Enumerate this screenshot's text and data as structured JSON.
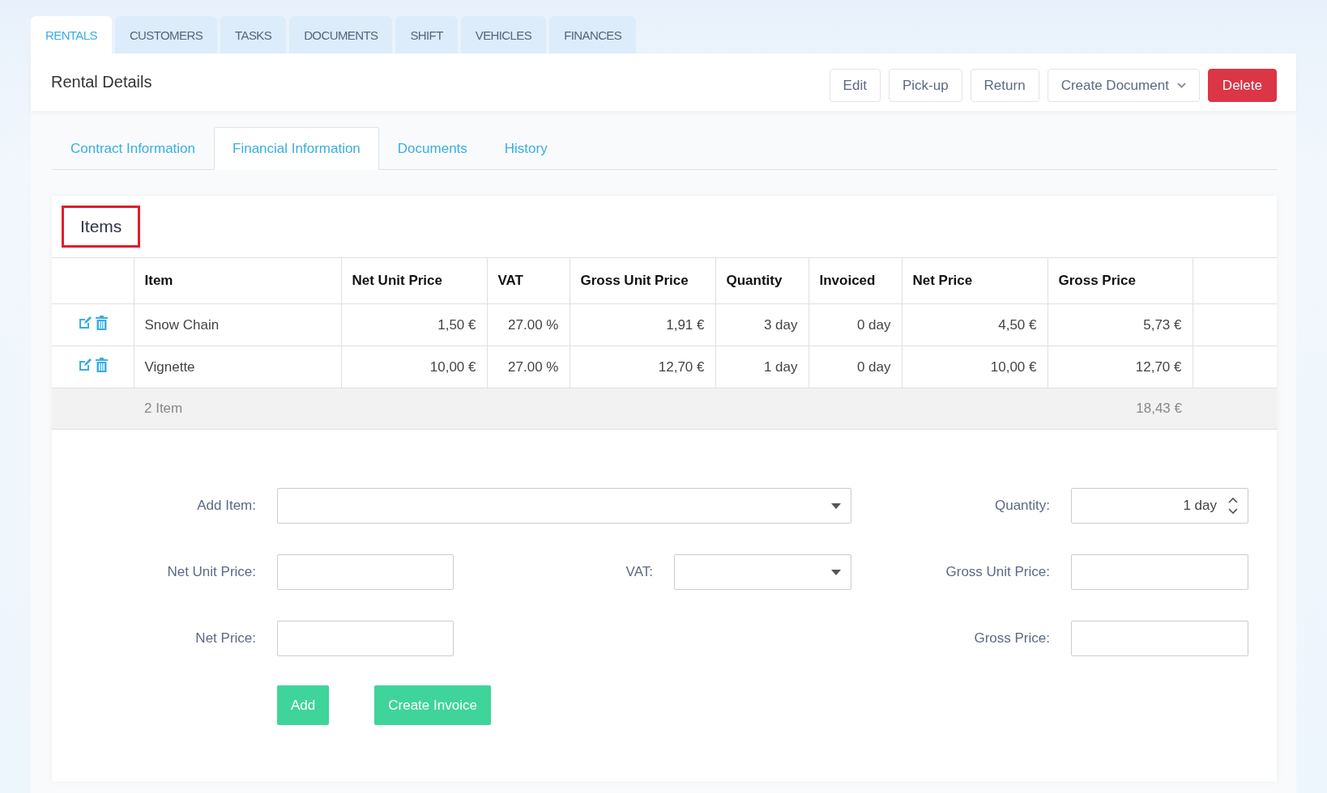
{
  "nav_tabs": [
    {
      "label": "RENTALS",
      "selected": true
    },
    {
      "label": "CUSTOMERS",
      "selected": false
    },
    {
      "label": "TASKS",
      "selected": false
    },
    {
      "label": "DOCUMENTS",
      "selected": false
    },
    {
      "label": "SHIFT",
      "selected": false
    },
    {
      "label": "VEHICLES",
      "selected": false
    },
    {
      "label": "FINANCES",
      "selected": false
    }
  ],
  "page": {
    "title": "Rental Details",
    "actions": [
      {
        "label": "Edit",
        "kind": "default"
      },
      {
        "label": "Pick-up",
        "kind": "default"
      },
      {
        "label": "Return",
        "kind": "default"
      },
      {
        "label": "Create Document",
        "kind": "dropdown"
      },
      {
        "label": "Delete",
        "kind": "danger"
      }
    ]
  },
  "sub_tabs": [
    {
      "label": "Contract Information",
      "selected": false
    },
    {
      "label": "Financial Information",
      "selected": true
    },
    {
      "label": "Documents",
      "selected": false
    },
    {
      "label": "History",
      "selected": false
    }
  ],
  "items_card": {
    "title": "Items",
    "highlighted": true,
    "columns": [
      "Item",
      "Net Unit Price",
      "VAT",
      "Gross Unit Price",
      "Quantity",
      "Invoiced",
      "Net Price",
      "Gross Price"
    ],
    "rows": [
      {
        "cells": [
          "Snow Chain",
          "1,50 €",
          "27.00 %",
          "1,91 €",
          "3 day",
          "0 day",
          "4,50 €",
          "5,73 €"
        ]
      },
      {
        "cells": [
          "Vignette",
          "10,00 €",
          "27.00 %",
          "12,70 €",
          "1 day",
          "0 day",
          "10,00 €",
          "12,70 €"
        ]
      }
    ],
    "footer": {
      "count": "2 Item",
      "total": "18,43 €"
    }
  },
  "form": {
    "rows": [
      [
        {
          "label": "Add Item:",
          "kind": "select",
          "wide": true
        },
        {
          "label": "Quantity:",
          "kind": "spinner",
          "value": "1 day"
        }
      ],
      [
        {
          "label": "Net Unit Price:",
          "kind": "input"
        },
        {
          "label": "VAT:",
          "kind": "select"
        },
        {
          "label": "Gross Unit Price:",
          "kind": "input"
        }
      ],
      [
        {
          "label": "Net Price:",
          "kind": "input"
        },
        {
          "label": "Gross Price:",
          "kind": "input"
        }
      ]
    ],
    "buttons": [
      "Add",
      "Create Invoice"
    ]
  }
}
